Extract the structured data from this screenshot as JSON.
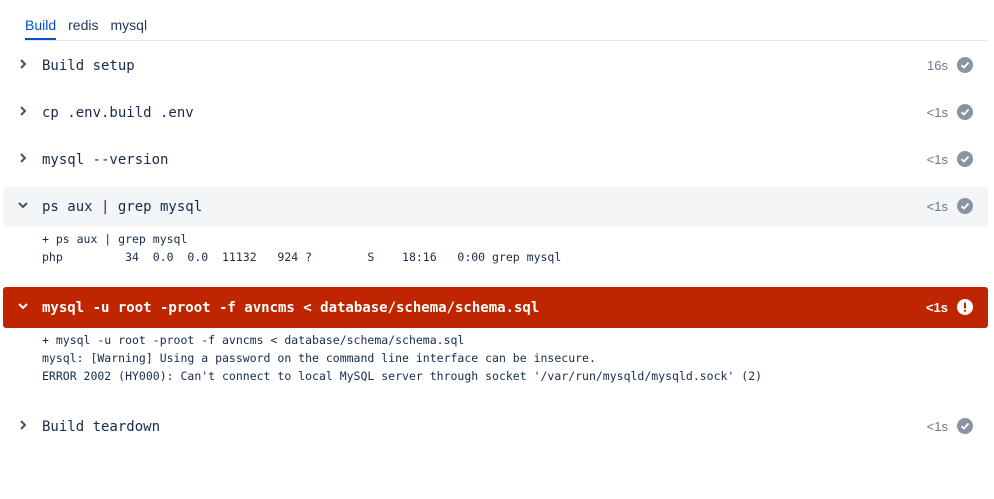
{
  "tabs": [
    {
      "label": "Build",
      "active": true
    },
    {
      "label": "redis",
      "active": false
    },
    {
      "label": "mysql",
      "active": false
    }
  ],
  "steps": [
    {
      "title": "Build setup",
      "duration": "16s",
      "status": "success",
      "expanded": false
    },
    {
      "title": "cp .env.build .env",
      "duration": "<1s",
      "status": "success",
      "expanded": false
    },
    {
      "title": "mysql --version",
      "duration": "<1s",
      "status": "success",
      "expanded": false
    },
    {
      "title": "ps aux | grep mysql",
      "duration": "<1s",
      "status": "success",
      "expanded": true,
      "log": [
        "+ ps aux | grep mysql",
        "php         34  0.0  0.0  11132   924 ?        S    18:16   0:00 grep mysql"
      ]
    },
    {
      "title": "mysql -u root -proot -f avncms < database/schema/schema.sql",
      "duration": "<1s",
      "status": "failed",
      "expanded": true,
      "log": [
        "+ mysql -u root -proot -f avncms < database/schema/schema.sql",
        "mysql: [Warning] Using a password on the command line interface can be insecure.",
        "ERROR 2002 (HY000): Can't connect to local MySQL server through socket '/var/run/mysqld/mysqld.sock' (2)"
      ]
    },
    {
      "title": "Build teardown",
      "duration": "<1s",
      "status": "success",
      "expanded": false
    }
  ],
  "colors": {
    "tab_active": "#0052cc",
    "failed_bg": "#bf2600",
    "success_icon": "#8993a4",
    "expanded_bg": "#f4f5f7"
  }
}
